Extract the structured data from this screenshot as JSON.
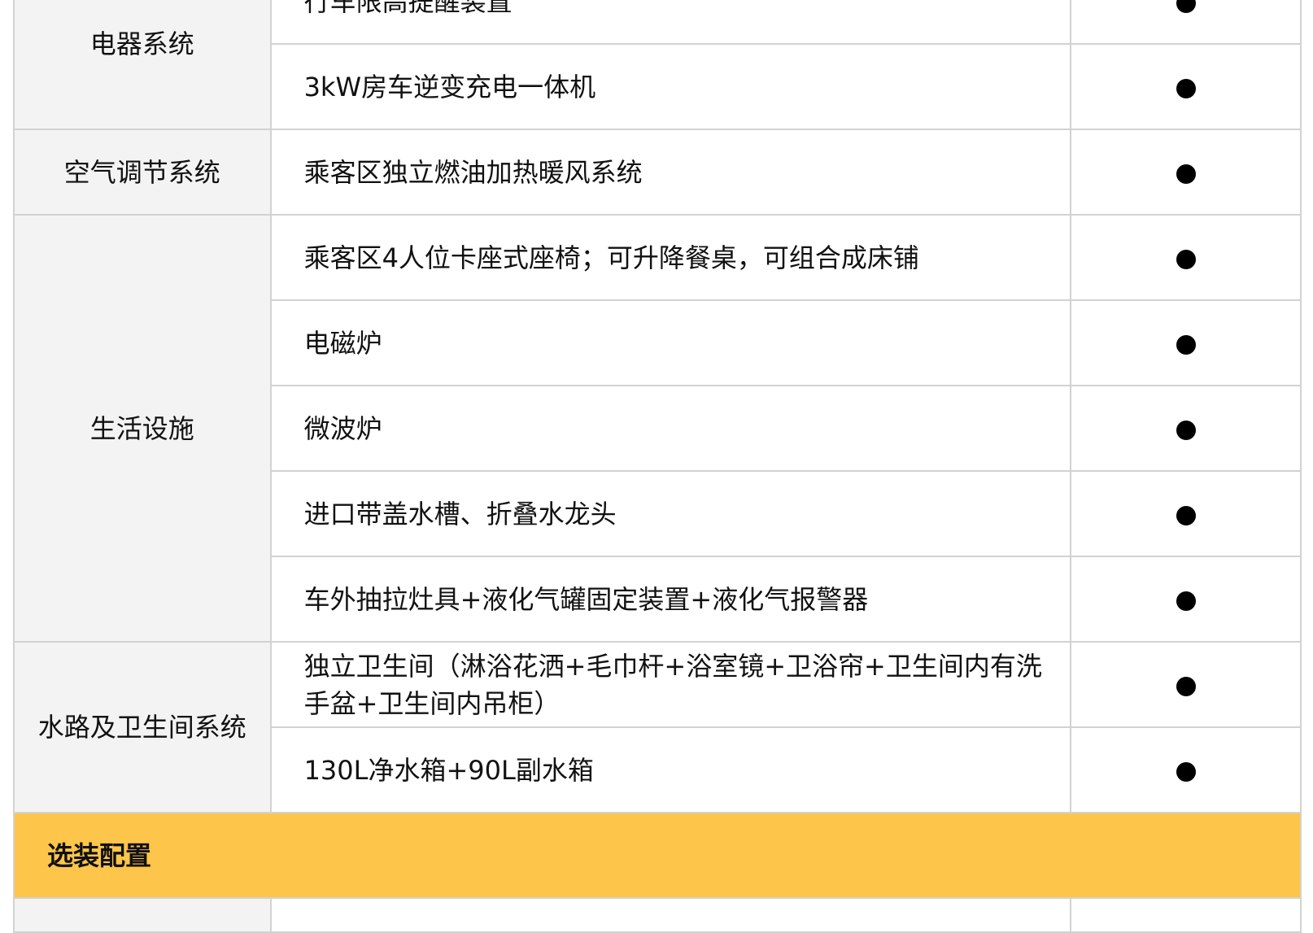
{
  "groups": [
    {
      "category": "电器系统",
      "items": [
        {
          "text": "行车限高提醒装置",
          "mark": "●"
        },
        {
          "text": "3kW房车逆变充电一体机",
          "mark": "●"
        }
      ]
    },
    {
      "category": "空气调节系统",
      "items": [
        {
          "text": "乘客区独立燃油加热暖风系统",
          "mark": "●"
        }
      ]
    },
    {
      "category": "生活设施",
      "items": [
        {
          "text": "乘客区4人位卡座式座椅；可升降餐桌，可组合成床铺",
          "mark": "●"
        },
        {
          "text": "电磁炉",
          "mark": "●"
        },
        {
          "text": "微波炉",
          "mark": "●"
        },
        {
          "text": "进口带盖水槽、折叠水龙头",
          "mark": "●"
        },
        {
          "text": "车外抽拉灶具+液化气罐固定装置+液化气报警器",
          "mark": "●"
        }
      ]
    },
    {
      "category": "水路及卫生间系统",
      "items": [
        {
          "text": "独立卫生间（淋浴花洒+毛巾杆+浴室镜+卫浴帘+卫生间内有洗手盆+卫生间内吊柜）",
          "mark": "●"
        },
        {
          "text": "130L净水箱+90L副水箱",
          "mark": "●"
        }
      ]
    }
  ],
  "section_header": "选装配置",
  "colors": {
    "section_bg": "#fdc54a",
    "category_bg": "#f3f3f3",
    "border": "#d2d2d2"
  }
}
